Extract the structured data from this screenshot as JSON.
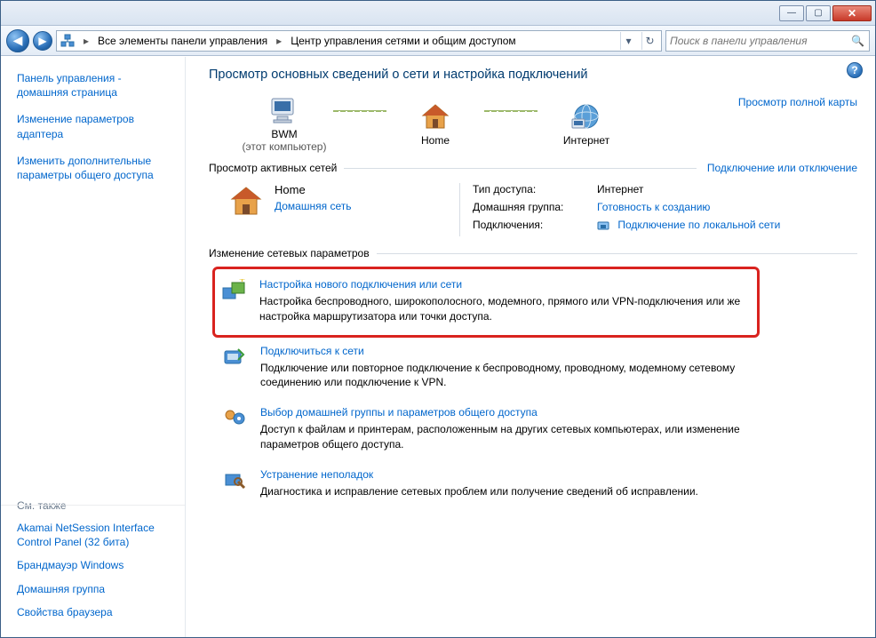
{
  "window": {
    "breadcrumb_root": "Все элементы панели управления",
    "breadcrumb_current": "Центр управления сетями и общим доступом",
    "search_placeholder": "Поиск в панели управления"
  },
  "left_nav": {
    "links": [
      "Панель управления - домашняя страница",
      "Изменение параметров адаптера",
      "Изменить дополнительные параметры общего доступа"
    ],
    "see_also_title": "См. также",
    "see_also": [
      "Akamai NetSession Interface Control Panel (32 бита)",
      "Брандмауэр Windows",
      "Домашняя группа",
      "Свойства браузера"
    ]
  },
  "main": {
    "heading": "Просмотр основных сведений о сети и настройка подключений",
    "map_link": "Просмотр полной карты",
    "nodes": {
      "computer_label": "BWM",
      "computer_sub": "(этот компьютер)",
      "home_label": "Home",
      "internet_label": "Интернет"
    },
    "active_header": "Просмотр активных сетей",
    "active_right_link": "Подключение или отключение",
    "active": {
      "name": "Home",
      "type": "Домашняя сеть",
      "kv": {
        "access_label": "Тип доступа:",
        "access_value": "Интернет",
        "homegroup_label": "Домашняя группа:",
        "homegroup_value": "Готовность к созданию",
        "connections_label": "Подключения:",
        "connections_value": "Подключение по локальной сети"
      }
    },
    "settings_header": "Изменение сетевых параметров",
    "settings": [
      {
        "title": "Настройка нового подключения или сети",
        "desc": "Настройка беспроводного, широкополосного, модемного, прямого или VPN-подключения или же настройка маршрутизатора или точки доступа."
      },
      {
        "title": "Подключиться к сети",
        "desc": "Подключение или повторное подключение к беспроводному, проводному, модемному сетевому соединению или подключение к VPN."
      },
      {
        "title": "Выбор домашней группы и параметров общего доступа",
        "desc": "Доступ к файлам и принтерам, расположенным на других сетевых компьютерах, или изменение параметров общего доступа."
      },
      {
        "title": "Устранение неполадок",
        "desc": "Диагностика и исправление сетевых проблем или получение сведений об исправлении."
      }
    ]
  }
}
